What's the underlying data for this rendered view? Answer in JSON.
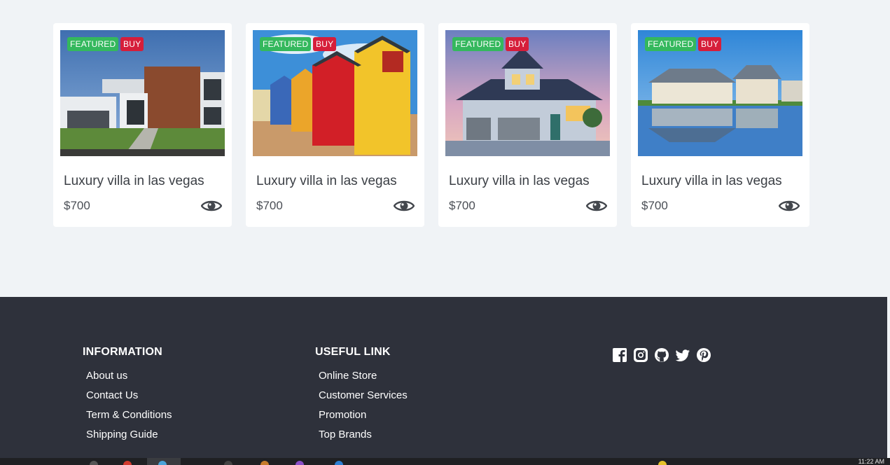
{
  "listings": [
    {
      "featured_badge": "FEATURED",
      "type_badge": "BUY",
      "title": "Luxury villa in las vegas",
      "price": "$700",
      "image": "modern-villa-photo"
    },
    {
      "featured_badge": "FEATURED",
      "type_badge": "BUY",
      "title": "Luxury villa in las vegas",
      "price": "$700",
      "image": "beach-huts-photo"
    },
    {
      "featured_badge": "FEATURED",
      "type_badge": "BUY",
      "title": "Luxury villa in las vegas",
      "price": "$700",
      "image": "suburban-house-photo"
    },
    {
      "featured_badge": "FEATURED",
      "type_badge": "BUY",
      "title": "Luxury villa in las vegas",
      "price": "$700",
      "image": "waterfront-homes-photo"
    }
  ],
  "footer": {
    "information": {
      "heading": "INFORMATION",
      "links": [
        "About us",
        "Contact Us",
        "Term & Conditions",
        "Shipping Guide"
      ]
    },
    "useful_link": {
      "heading": "USEFUL LINK",
      "links": [
        "Online Store",
        "Customer Services",
        "Promotion",
        "Top Brands"
      ]
    },
    "social_icons": [
      "facebook-icon",
      "instagram-icon",
      "github-icon",
      "twitter-icon",
      "pinterest-icon"
    ]
  },
  "colors": {
    "page_bg": "#f0f3f6",
    "footer_bg": "#2e313b",
    "featured_badge": "#34b85d",
    "buy_badge": "#d61e3a"
  },
  "taskbar": {
    "clock": "11:22 AM"
  }
}
